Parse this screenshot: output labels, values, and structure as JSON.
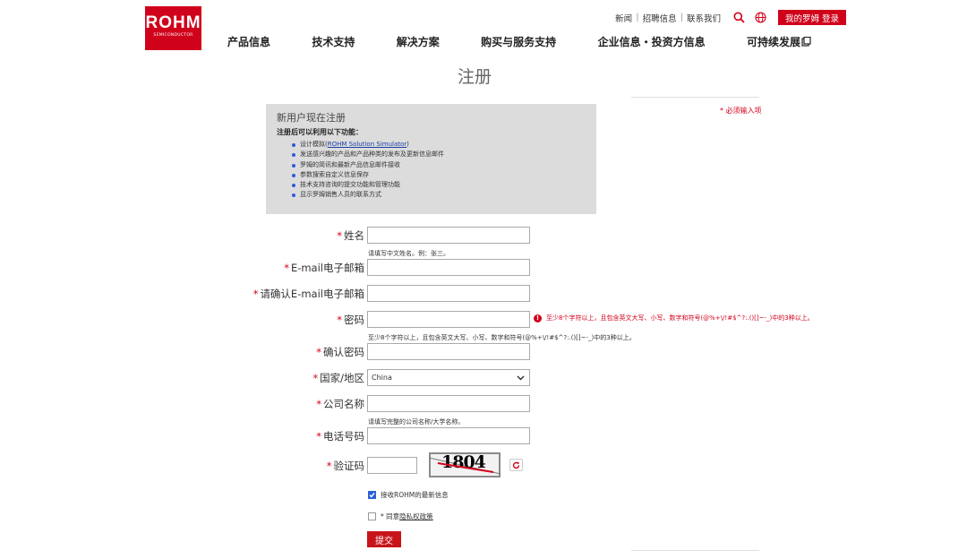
{
  "header": {
    "logo_main": "ROHM",
    "logo_sub": "SEMICONDUCTOR",
    "top_links": [
      "新闻",
      "招聘信息",
      "联系我们"
    ],
    "my_rohm_label": "我的罗姆 登录"
  },
  "nav": {
    "items": [
      "产品信息",
      "技术支持",
      "解决方案",
      "购买与服务支持",
      "企业信息・投资方信息",
      "可持续发展"
    ]
  },
  "page": {
    "title": "注册",
    "required_note": "* 必须输入项"
  },
  "info_box": {
    "title": "新用户现在注册",
    "subtitle": "注册后可以利用以下功能：",
    "item0_prefix": "设计模拟(",
    "item0_link": "ROHM Solution Simulator",
    "item0_suffix": ")",
    "items": [
      "发送感兴趣的产品和产品种类的发布及更新信息邮件",
      "罗姆的简讯和最新产品信息邮件接收",
      "参数搜索自定义信息保存",
      "技术支持咨询的提交功能和管理功能",
      "显示罗姆销售人员的联系方式"
    ]
  },
  "form": {
    "required_mark": "*",
    "name_label": "姓名",
    "name_hint": "请填写中文姓名。例：张三。",
    "email_label": "E-mail电子邮箱",
    "email_confirm_label": "请确认E-mail电子邮箱",
    "password_label": "密码",
    "password_error": "至少8个字符以上，且包含英文大写、小写、数字和符号(@%+\\/!#$^?:.()[]~-_)中的3种以上。",
    "password_hint": "至少8个字符以上，且包含英文大写、小写、数字和符号(@%+\\/!#$^?:.()[]~-_)中的3种以上。",
    "password_confirm_label": "确认密码",
    "country_label": "国家/地区",
    "country_value": "China",
    "company_label": "公司名称",
    "company_hint": "请填写完整的公司名称/大学名称。",
    "phone_label": "电话号码",
    "captcha_label": "验证码",
    "captcha_text": "1804",
    "newsletter_label": "接收ROHM的最新信息",
    "privacy_prefix": "* 同意",
    "privacy_link": "隐私权政策",
    "submit_label": "提交"
  },
  "colors": {
    "brand_red": "#d0021b",
    "info_bg": "#dcdcdc",
    "checkbox_blue": "#2a62d6"
  }
}
